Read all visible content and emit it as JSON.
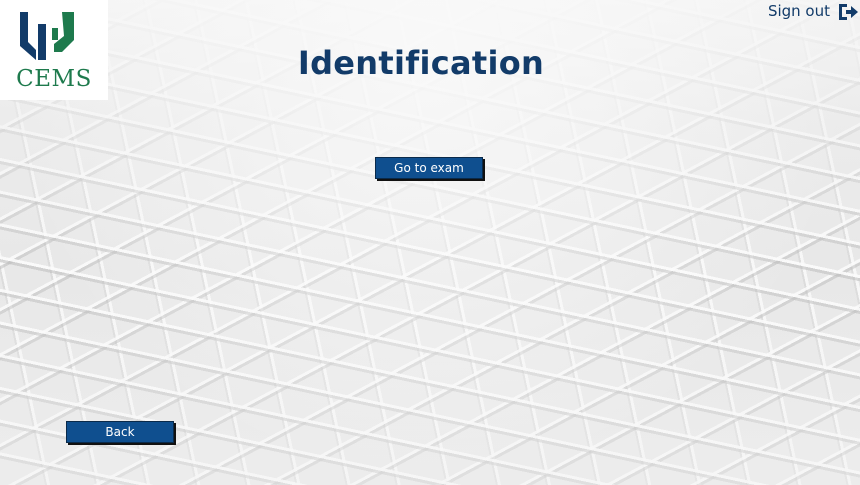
{
  "logo": {
    "text": "CEMS",
    "colors": {
      "navy": "#123b69",
      "green": "#1e7a4d"
    }
  },
  "header": {
    "signout_label": "Sign out",
    "signout_icon": "sign-out-icon"
  },
  "page": {
    "title": "Identification"
  },
  "buttons": {
    "go_to_exam": "Go to exam",
    "back": "Back"
  },
  "colors": {
    "primary": "#123b69",
    "button": "#0f4f8f"
  }
}
